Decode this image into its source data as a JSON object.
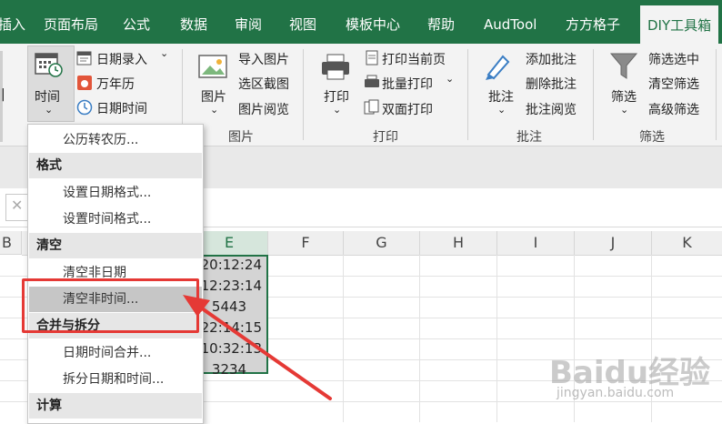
{
  "tabs": [
    "插入",
    "页面布局",
    "公式",
    "数据",
    "审阅",
    "视图",
    "模板中心",
    "帮助",
    "AudTool",
    "方方格子",
    "DIY工具箱"
  ],
  "ribbon": {
    "time_button": "时间",
    "date_entry": "日期录入",
    "perpetual_calendar": "万年历",
    "date_time": "日期时间",
    "picture_button": "图片",
    "import_picture": "导入图片",
    "screenshot_region": "选区截图",
    "picture_view": "图片阅览",
    "print_button": "打印",
    "print_current_page": "打印当前页",
    "batch_print": "批量打印",
    "duplex_print": "双面打印",
    "annotate_button": "批注",
    "add_annotation": "添加批注",
    "delete_annotation": "删除批注",
    "annotation_view": "批注阅览",
    "filter_button": "筛选",
    "filter_selected": "筛选选中",
    "clear_filter": "清空筛选",
    "advanced_filter": "高级筛选",
    "groups": {
      "picture": "图片",
      "print": "打印",
      "annotation": "批注",
      "filter": "筛选"
    }
  },
  "formula_bar": {
    "cancel": "✕"
  },
  "columns": [
    "B",
    "E",
    "F",
    "G",
    "H",
    "I",
    "J",
    "K"
  ],
  "cells_e": [
    "20:12:24",
    "12:23:14",
    "5443",
    "22:14:15",
    "10:32:13",
    "3234"
  ],
  "menu": {
    "items": [
      {
        "kind": "item",
        "label": "公历转农历..."
      },
      {
        "kind": "header",
        "label": "格式"
      },
      {
        "kind": "item",
        "label": "设置日期格式..."
      },
      {
        "kind": "item",
        "label": "设置时间格式..."
      },
      {
        "kind": "header",
        "label": "清空"
      },
      {
        "kind": "item",
        "label": "清空非日期"
      },
      {
        "kind": "item",
        "label": "清空非时间...",
        "highlighted": true
      },
      {
        "kind": "header",
        "label": "合并与拆分"
      },
      {
        "kind": "item",
        "label": "日期时间合并..."
      },
      {
        "kind": "item",
        "label": "拆分日期和时间..."
      },
      {
        "kind": "header",
        "label": "计算"
      }
    ]
  },
  "watermark": {
    "main": "Baidu经验",
    "sub": "jingyan.baidu.com"
  },
  "colors": {
    "accent": "#217346",
    "annotation": "#e53935"
  }
}
